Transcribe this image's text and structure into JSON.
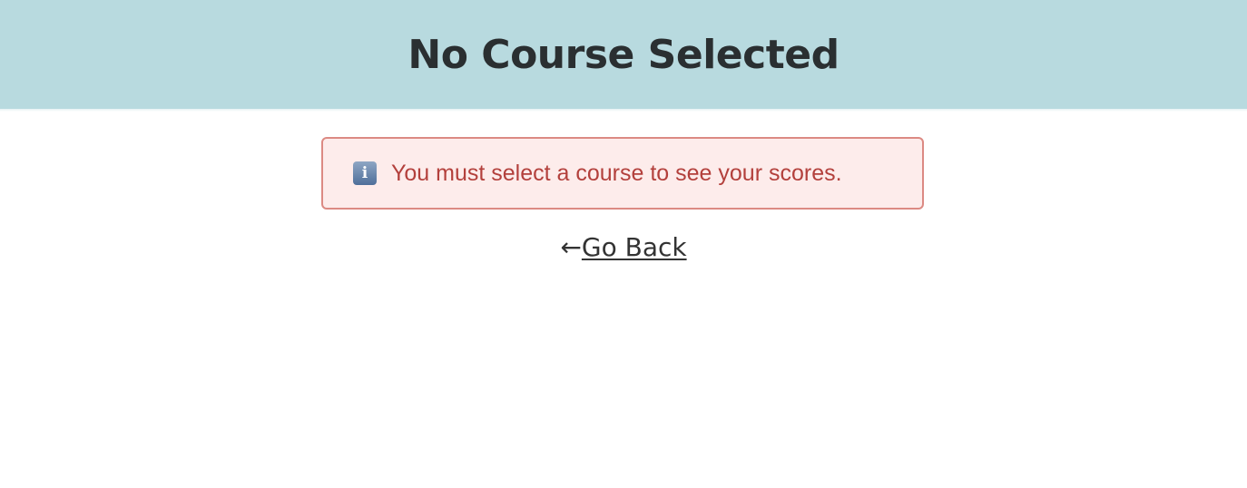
{
  "header": {
    "title": "No Course Selected",
    "background_color": "#b8dadf"
  },
  "alert": {
    "icon": "info-icon",
    "icon_glyph": "i",
    "message": "You must select a course to see your scores.",
    "text_color": "#b3403c",
    "background_color": "#fdeceb",
    "border_color": "#dc8a83"
  },
  "back_link": {
    "arrow": "←",
    "label": "Go Back"
  }
}
